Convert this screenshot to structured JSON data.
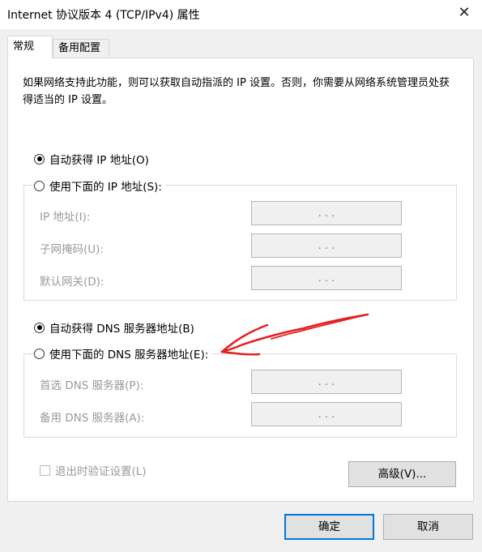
{
  "window": {
    "title": "Internet 协议版本 4 (TCP/IPv4) 属性",
    "close_glyph": "✕"
  },
  "tabs": [
    {
      "label": "常规"
    },
    {
      "label": "备用配置"
    }
  ],
  "description": "如果网络支持此功能，则可以获取自动指派的 IP 设置。否则，你需要从网络系统管理员处获得适当的 IP 设置。",
  "ip_section": {
    "auto_label": "自动获得 IP 地址(O)",
    "manual_label": "使用下面的 IP 地址(S):",
    "selected": "auto",
    "fields": [
      {
        "label": "IP 地址(I):",
        "value": ".   .   ."
      },
      {
        "label": "子网掩码(U):",
        "value": ".   .   ."
      },
      {
        "label": "默认网关(D):",
        "value": ".   .   ."
      }
    ]
  },
  "dns_section": {
    "auto_label": "自动获得 DNS 服务器地址(B)",
    "manual_label": "使用下面的 DNS 服务器地址(E):",
    "selected": "auto",
    "fields": [
      {
        "label": "首选 DNS 服务器(P):",
        "value": ".   .   ."
      },
      {
        "label": "备用 DNS 服务器(A):",
        "value": ".   .   ."
      }
    ]
  },
  "validate_checkbox": {
    "label": "退出时验证设置(L)",
    "checked": false
  },
  "buttons": {
    "advanced": "高级(V)...",
    "ok": "确定",
    "cancel": "取消"
  },
  "annotation_color": "#e32020"
}
